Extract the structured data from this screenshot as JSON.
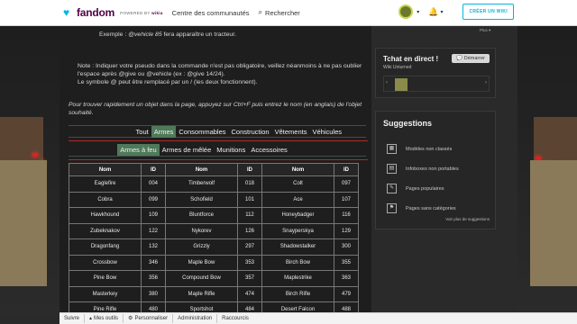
{
  "topnav": {
    "brand": "fandom",
    "powered_prefix": "POWERED BY",
    "powered_brand": "wikia",
    "community_link": "Centre des communautés",
    "search_placeholder": "Rechercher",
    "create_button": "CRÉER UN WIKI"
  },
  "main": {
    "example_label": "Exemple : ",
    "example_command": "@vehicle 85",
    "example_tail": " fera apparaître un tracteur.",
    "note_line1": "Note : Indiquer votre pseudo dans la commande n'est pas obligatoire, veillez néanmoins à ne pas oublier",
    "note_line2": "l'espace après @give ou @vehicle (ex : @give 14/24).",
    "note_line3": "Le symbole @ peut être remplacé par un / (les deux fonctionnent).",
    "find_hint": "Pour trouver rapidement un objet dans la page, appuyez sur Ctrl+F puis entrez le nom (en anglais) de l'objet souhaité.",
    "tabs": [
      "Tout",
      "Armes",
      "Consommables",
      "Construction",
      "Vêtements",
      "Véhicules"
    ],
    "subtabs": [
      "Armes à feu",
      "Armes de mêlée",
      "Munitions",
      "Accessoires"
    ],
    "table": {
      "headers": [
        "Nom",
        "ID",
        "Nom",
        "ID",
        "Nom",
        "ID"
      ],
      "rows": [
        [
          "Eaglefire",
          "004",
          "Timberwolf",
          "018",
          "Colt",
          "097"
        ],
        [
          "Cobra",
          "099",
          "Schofield",
          "101",
          "Ace",
          "107"
        ],
        [
          "Hawkhound",
          "109",
          "Bluntforce",
          "112",
          "Honeybadger",
          "116"
        ],
        [
          "Zubeknakov",
          "122",
          "Nykorev",
          "126",
          "Snayperskya",
          "129"
        ],
        [
          "Dragonfang",
          "132",
          "Grizzly",
          "297",
          "Shadowstalker",
          "300"
        ],
        [
          "Crossbow",
          "346",
          "Maple Bow",
          "353",
          "Birch Bow",
          "355"
        ],
        [
          "Pine Bow",
          "356",
          "Compound Bow",
          "357",
          "Maplestrike",
          "363"
        ],
        [
          "Masterkey",
          "380",
          "Maple Rifle",
          "474",
          "Birch Rifle",
          "479"
        ],
        [
          "Pine Rifle",
          "480",
          "Sportshot",
          "484",
          "Desert Falcon",
          "488"
        ]
      ]
    }
  },
  "rail": {
    "plus_link": "Plus",
    "chat_title": "Tchat en direct !",
    "chat_subtitle": "Wiki Unturned",
    "chat_button": "Démarrer",
    "suggestions_title": "Suggestions",
    "suggestions": [
      "Modèles non classés",
      "Infoboxes non portables",
      "Pages populaires",
      "Pages sans catégories"
    ],
    "more_suggestions": "Voir plus de suggestions"
  },
  "toolbar": {
    "items": [
      "Suivre",
      "Mes outils",
      "Personnaliser",
      "Administration",
      "Raccourcis"
    ]
  }
}
